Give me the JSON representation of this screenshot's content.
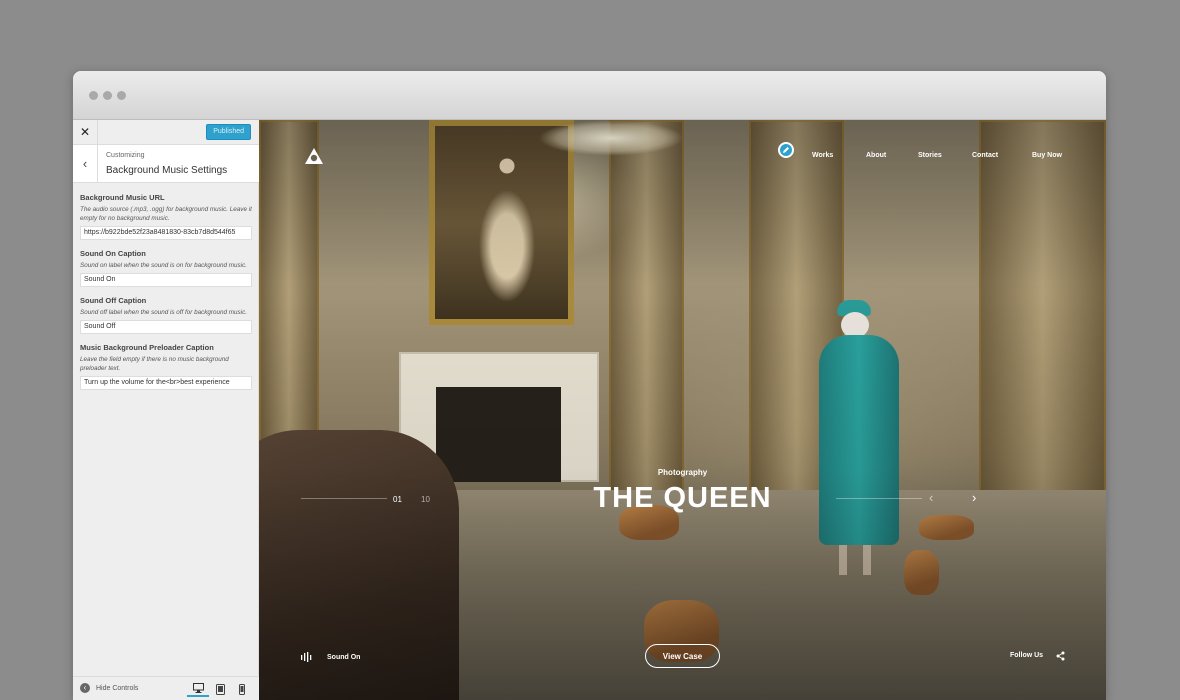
{
  "customizer": {
    "publish_label": "Published",
    "breadcrumb": "Customizing",
    "section_title": "Background Music Settings",
    "controls": [
      {
        "label": "Background Music URL",
        "description": "The audio source (.mp3, .ogg) for background music. Leave it empty for no background music.",
        "value": "https://b922bde52f23a8481830-83cb7d8d544f65"
      },
      {
        "label": "Sound On Caption",
        "description": "Sound on label when the sound is on for background music.",
        "value": "Sound On"
      },
      {
        "label": "Sound Off Caption",
        "description": "Sound off label when the sound is off for background music.",
        "value": "Sound Off"
      },
      {
        "label": "Music Background Preloader Caption",
        "description": "Leave the field empty if there is no music background preloader text.",
        "value": "Turn up the volume for the<br>best experience"
      }
    ],
    "hide_controls_label": "Hide Controls",
    "accent_color": "#2ea2cc"
  },
  "site": {
    "nav": [
      "Works",
      "About",
      "Stories",
      "Contact",
      "Buy Now"
    ],
    "slide": {
      "category": "Photography",
      "title": "THE QUEEN",
      "current": "01",
      "total": "10"
    },
    "sound_label": "Sound On",
    "cta_label": "View Case",
    "follow_label": "Follow Us"
  }
}
